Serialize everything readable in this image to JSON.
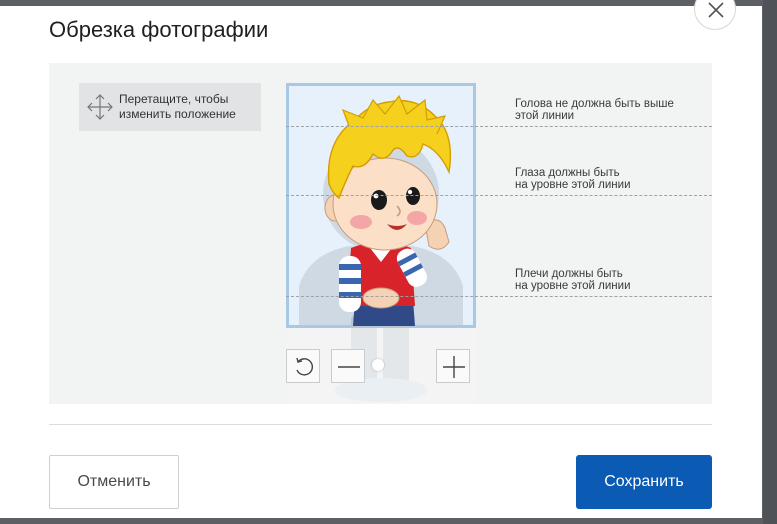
{
  "modal": {
    "title": "Обрезка фотографии",
    "close_icon": "close-icon"
  },
  "hint": {
    "icon": "drag-arrows-icon",
    "line1": "Перетащите, чтобы",
    "line2": "изменить положение"
  },
  "guides": [
    {
      "line1": "Голова не должна быть выше",
      "line2": "этой линии"
    },
    {
      "line1": "Глаза должны быть",
      "line2": "на уровне этой линии"
    },
    {
      "line1": "Плечи должны быть",
      "line2": "на уровне этой линии"
    }
  ],
  "controls": {
    "rotate_icon": "rotate-left-icon",
    "zoom_out_icon": "minus-icon",
    "zoom_in_icon": "plus-icon",
    "zoom_value": 0.45
  },
  "footer": {
    "cancel_label": "Отменить",
    "save_label": "Сохранить"
  },
  "colors": {
    "primary": "#0b5ab3",
    "frame_border": "#a9c8e6",
    "stage_background": "#f2f4f3"
  }
}
